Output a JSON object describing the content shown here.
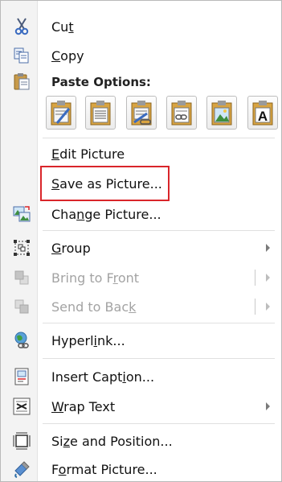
{
  "menu": {
    "cut": {
      "pre": "Cu",
      "key": "t",
      "post": ""
    },
    "copy": {
      "pre": "",
      "key": "C",
      "post": "opy"
    },
    "paste_options_header": "Paste Options:",
    "paste_options": [
      {
        "icon": "paste-keep-formatting-icon"
      },
      {
        "icon": "paste-text-only-icon"
      },
      {
        "icon": "paste-merge-formatting-icon"
      },
      {
        "icon": "paste-link-icon"
      },
      {
        "icon": "paste-picture-icon"
      },
      {
        "icon": "paste-keep-text-icon",
        "glyph": "A"
      }
    ],
    "edit_picture": {
      "pre": "",
      "key": "E",
      "post": "dit Picture"
    },
    "save_as_picture": {
      "pre": "",
      "key": "S",
      "post": "ave as Picture..."
    },
    "change_picture": {
      "pre": "Cha",
      "key": "n",
      "post": "ge Picture..."
    },
    "group": {
      "pre": "",
      "key": "G",
      "post": "roup"
    },
    "bring_to_front": {
      "pre": "Bring to F",
      "key": "r",
      "post": "ont"
    },
    "send_to_back": {
      "pre": "Send to Bac",
      "key": "k",
      "post": ""
    },
    "hyperlink": {
      "pre": "Hyperl",
      "key": "i",
      "post": "nk..."
    },
    "insert_caption": {
      "pre": "Insert Capt",
      "key": "i",
      "post": "on..."
    },
    "wrap_text": {
      "pre": "",
      "key": "W",
      "post": "rap Text"
    },
    "size_position": {
      "pre": "Si",
      "key": "z",
      "post": "e and Position..."
    },
    "format_picture": {
      "pre": "F",
      "key": "o",
      "post": "rmat Picture..."
    }
  },
  "colors": {
    "highlight_border": "#d9252a",
    "disabled_text": "#a3a3a3"
  }
}
